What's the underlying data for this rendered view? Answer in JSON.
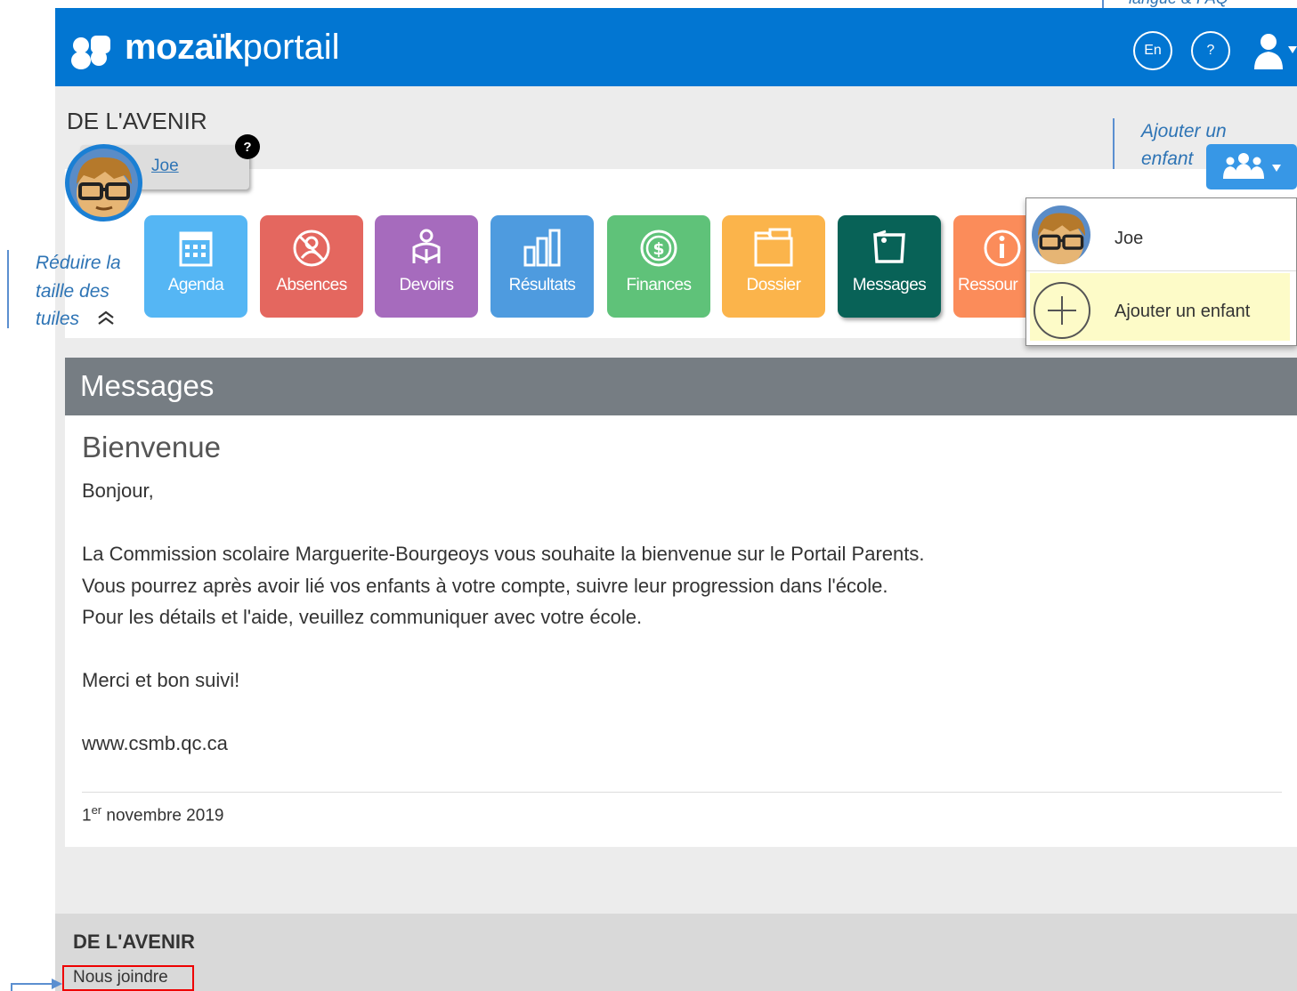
{
  "annotations": {
    "top_right": "langue & FAQ",
    "add_child_line1": "Ajouter un",
    "add_child_line2": "enfant",
    "reduce_line1": "Réduire la",
    "reduce_line2": "taille des",
    "reduce_line3": "tuiles",
    "reduce_icon": "⌃"
  },
  "header": {
    "logo_bold": "mozaïk",
    "logo_light": "portail",
    "lang_button": "En",
    "help_button": "?",
    "user_icon": "user-icon"
  },
  "school": {
    "name": "DE L'AVENIR"
  },
  "child": {
    "name": "Joe",
    "help_badge": "?"
  },
  "tiles": [
    {
      "label": "Agenda",
      "color": "#55b6f4",
      "icon": "calendar-icon"
    },
    {
      "label": "Absences",
      "color": "#e4675f",
      "icon": "absence-icon"
    },
    {
      "label": "Devoirs",
      "color": "#a66bbd",
      "icon": "homework-icon"
    },
    {
      "label": "Résultats",
      "color": "#4e9bdf",
      "icon": "results-icon"
    },
    {
      "label": "Finances",
      "color": "#5fc279",
      "icon": "finances-icon"
    },
    {
      "label": "Dossier",
      "color": "#fbb44b",
      "icon": "folder-icon"
    },
    {
      "label": "Messages",
      "color": "#086257",
      "icon": "messages-icon"
    },
    {
      "label": "Ressour",
      "color": "#fb8c5a",
      "icon": "resources-icon"
    }
  ],
  "messages": {
    "section_title": "Messages",
    "title": "Bienvenue",
    "greeting": "Bonjour,",
    "body_line1": "La Commission scolaire Marguerite-Bourgeoys vous souhaite la bienvenue sur le Portail Parents.",
    "body_line2": "Vous pourrez après avoir lié vos enfants à votre compte, suivre leur progression dans l'école.",
    "body_line3": "Pour les détails et l'aide, veuillez communiquer avec votre école.",
    "closing": "Merci et bon suivi!",
    "website": "www.csmb.qc.ca",
    "date_day": "1",
    "date_sup": "er",
    "date_rest": " novembre 2019"
  },
  "add_child_menu": {
    "items": [
      {
        "label": "Joe"
      },
      {
        "label": "Ajouter un enfant"
      }
    ]
  },
  "footer": {
    "school": "DE L'AVENIR",
    "contact_link": "Nous joindre"
  },
  "colors": {
    "brand_blue": "#0276d2",
    "section_header": "#767d83",
    "highlight": "#fdfbc8"
  }
}
